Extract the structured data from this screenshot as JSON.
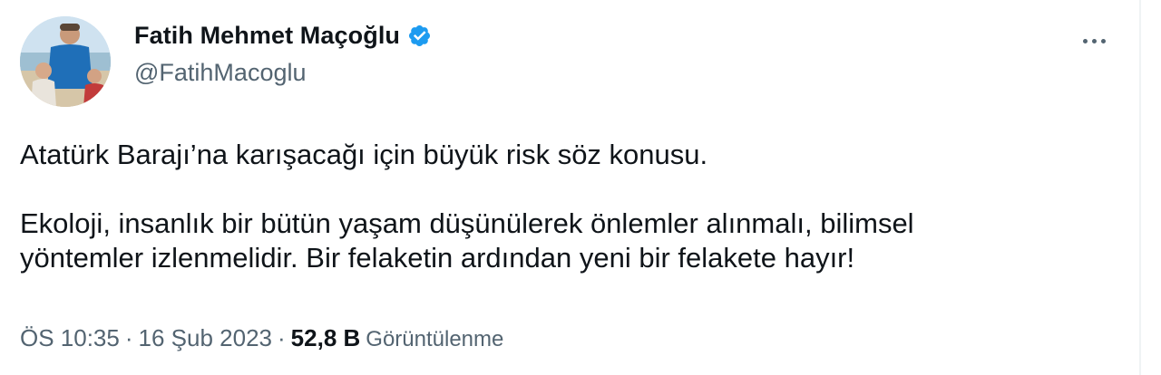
{
  "tweet": {
    "author": {
      "display_name": "Fatih Mehmet Maçoğlu",
      "handle": "@FatihMacoglu",
      "verified": true
    },
    "body": {
      "paragraph_1": "Atatürk Barajı’na karışacağı için büyük risk söz konusu.",
      "paragraph_2_line_1": "Ekoloji, insanlık bir bütün yaşam düşünülerek önlemler alınmalı, bilimsel",
      "paragraph_2_line_2": "yöntemler izlenmelidir. Bir felaketin ardından yeni bir felakete hayır!"
    },
    "meta": {
      "time": "ÖS 10:35",
      "separator": "·",
      "date": "16 Şub 2023",
      "views_count": "52,8 B",
      "views_label": "Görüntülenme"
    },
    "more_icon": "more-horizontal-icon",
    "colors": {
      "text_primary": "#0f1419",
      "text_secondary": "#536471",
      "verified_blue": "#1d9bf0"
    }
  }
}
